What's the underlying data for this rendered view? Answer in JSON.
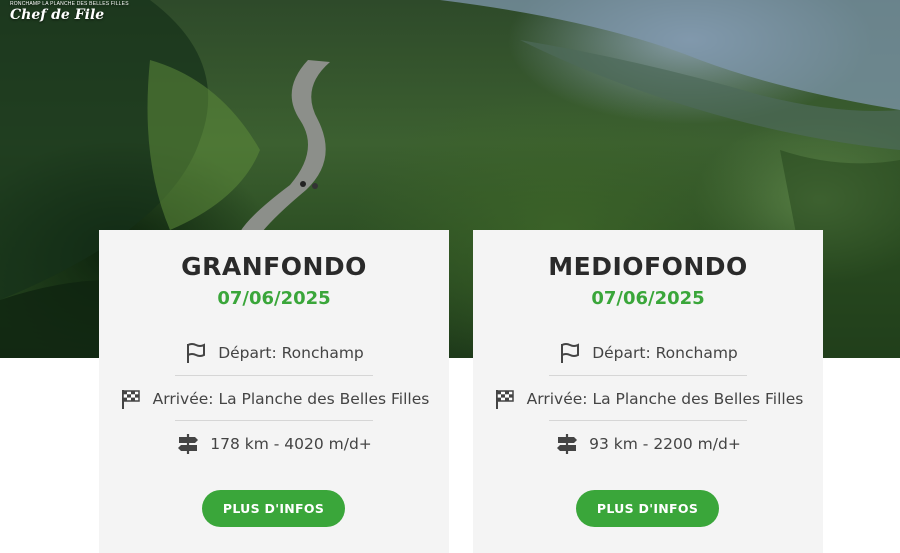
{
  "logo": {
    "tagline": "RONCHAMP LA PLANCHE DES BELLES FILLES",
    "name": "Chef de File"
  },
  "cards": [
    {
      "title": "GRANFONDO",
      "date": "07/06/2025",
      "depart": "Départ: Ronchamp",
      "arrivee": "Arrivée: La Planche des Belles Filles",
      "distance": "178 km - 4020 m/d+",
      "button": "PLUS D'INFOS"
    },
    {
      "title": "MEDIOFONDO",
      "date": "07/06/2025",
      "depart": "Départ: Ronchamp",
      "arrivee": "Arrivée: La Planche des Belles Filles",
      "distance": "93 km - 2200 m/d+",
      "button": "PLUS D'INFOS"
    }
  ],
  "colors": {
    "accent_green": "#3aa63a",
    "card_bg": "#f4f4f4",
    "title_text": "#2a2a2a"
  },
  "icons": [
    "flag-icon",
    "checkered-flag-icon",
    "signpost-icon"
  ]
}
